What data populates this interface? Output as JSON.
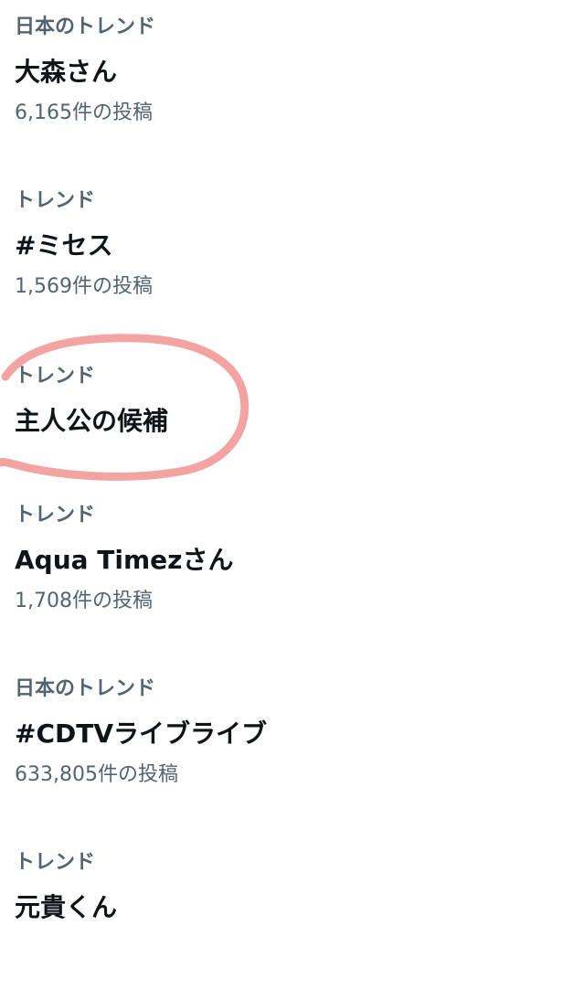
{
  "trends": [
    {
      "context": "日本のトレンド",
      "title": "大森さん",
      "count": "6,165件の投稿"
    },
    {
      "context": "トレンド",
      "title": "#ミセス",
      "count": "1,569件の投稿"
    },
    {
      "context": "トレンド",
      "title": "主人公の候補",
      "count": ""
    },
    {
      "context": "トレンド",
      "title": "Aqua Timezさん",
      "count": "1,708件の投稿"
    },
    {
      "context": "日本のトレンド",
      "title": "#CDTVライブライブ",
      "count": "633,805件の投稿"
    },
    {
      "context": "トレンド",
      "title": "元貴くん",
      "count": ""
    }
  ],
  "annotation": {
    "color": "#f4a3a3"
  }
}
